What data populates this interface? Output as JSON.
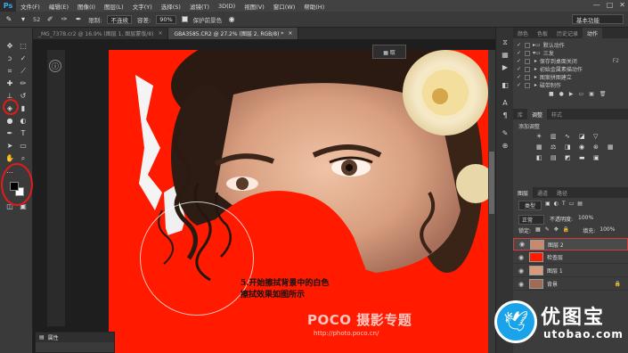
{
  "app": {
    "logo": "Ps"
  },
  "menu": [
    "文件(F)",
    "编辑(E)",
    "图像(I)",
    "图层(L)",
    "文字(Y)",
    "选择(S)",
    "滤镜(T)",
    "3D(D)",
    "视图(V)",
    "窗口(W)",
    "帮助(H)"
  ],
  "window_controls": {
    "minimize": "—",
    "maximize": "□",
    "close": "✕"
  },
  "options": {
    "size_value": "52",
    "limit_label": "限制:",
    "limit_value": "不连续",
    "tolerance_label": "容差:",
    "tolerance_value": "90%",
    "protect_label": "保护前景色",
    "workspace": "基本功能"
  },
  "tabs": [
    {
      "label": "_MG_7378.cr2 @ 16.9% (图层 1, 图层蒙版/8)",
      "active": false
    },
    {
      "label": "GBA3585.CR2 @ 27.2% (图层 2, RGB/8) *",
      "active": true
    }
  ],
  "canvas": {
    "annotation_line1": "5.开始擦拭背景中的白色",
    "annotation_line2": "擦拭效果如图所示",
    "watermark": "POCO 摄影专题",
    "watermark_url": "http://photo.poco.cn/",
    "badge": "▦ 取"
  },
  "properties_panel": {
    "title": "属性"
  },
  "panels": {
    "top_tabs": [
      "颜色",
      "色板",
      "历史记录",
      "动作"
    ],
    "actions": [
      {
        "label": "默认动作",
        "key": ""
      },
      {
        "label": "三发",
        "key": ""
      },
      {
        "label": "保存到桌面关闭",
        "key": "F2"
      },
      {
        "label": "初始金属素描动作",
        "key": ""
      },
      {
        "label": "图案拼图建立",
        "key": ""
      },
      {
        "label": "磁带制作",
        "key": ""
      }
    ],
    "mid_tabs": [
      "库",
      "调整",
      "样式"
    ],
    "adjust_title": "添加调整",
    "layer_tabs": [
      "图层",
      "通道",
      "路径"
    ],
    "layer_filter": "类型",
    "blend_mode": "正常",
    "opacity_label": "不透明度:",
    "opacity_value": "100%",
    "lock_label": "锁定:",
    "fill_label": "填充:",
    "fill_value": "100%",
    "layers": [
      {
        "name": "图层 2",
        "selected": true,
        "thumb": "#c9896b"
      },
      {
        "name": "检查层",
        "selected": false,
        "thumb": "#ff1a00"
      },
      {
        "name": "图层 1",
        "selected": false,
        "thumb": "#d99a7a"
      },
      {
        "name": "背景",
        "selected": false,
        "thumb": "#a06a55"
      }
    ]
  },
  "brand": {
    "name": "优图宝",
    "url": "utobao.com"
  },
  "colors": {
    "canvas_red": "#ff1a00",
    "brand_blue": "#1aa3e8"
  }
}
